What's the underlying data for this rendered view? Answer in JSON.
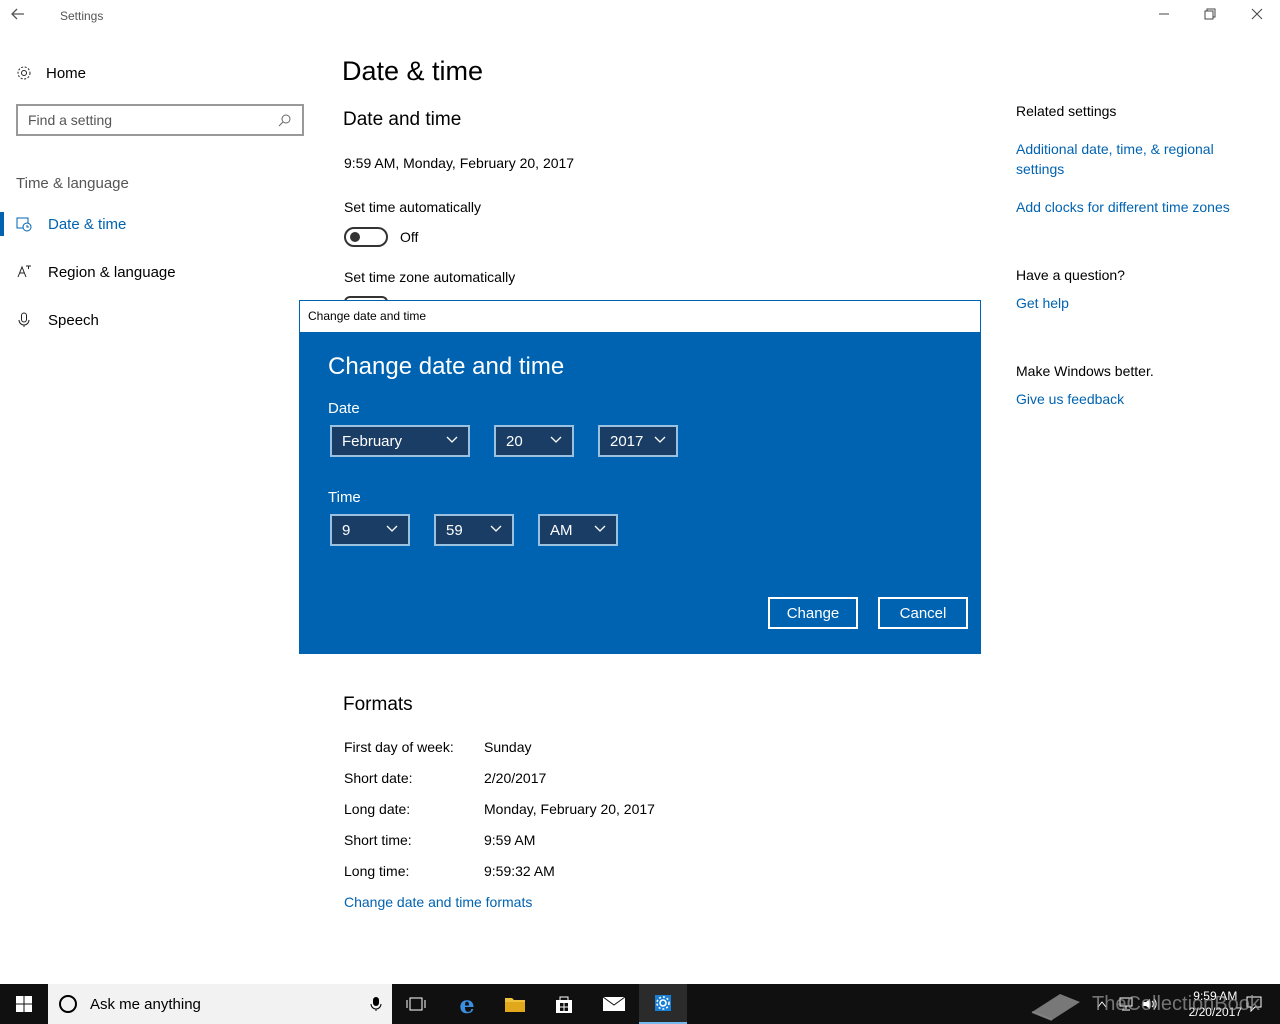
{
  "app": {
    "title": "Settings"
  },
  "sidebar": {
    "home": "Home",
    "search_placeholder": "Find a setting",
    "section": "Time & language",
    "items": [
      {
        "label": "Date & time",
        "icon": "calendar-clock-icon",
        "active": true
      },
      {
        "label": "Region & language",
        "icon": "language-icon",
        "active": false
      },
      {
        "label": "Speech",
        "icon": "microphone-icon",
        "active": false
      }
    ]
  },
  "main": {
    "page_title": "Date & time",
    "section_title": "Date and time",
    "current_datetime": "9:59 AM, Monday, February 20, 2017",
    "set_time_auto_label": "Set time automatically",
    "set_time_auto_state": "Off",
    "set_tz_auto_label": "Set time zone automatically",
    "formats": {
      "title": "Formats",
      "rows": [
        {
          "key": "First day of week:",
          "value": "Sunday"
        },
        {
          "key": "Short date:",
          "value": "2/20/2017"
        },
        {
          "key": "Long date:",
          "value": "Monday, February 20, 2017"
        },
        {
          "key": "Short time:",
          "value": "9:59 AM"
        },
        {
          "key": "Long time:",
          "value": "9:59:32 AM"
        }
      ],
      "change_link": "Change date and time formats"
    }
  },
  "related": {
    "title": "Related settings",
    "link1": "Additional date, time, & regional settings",
    "link2": "Add clocks for different time zones",
    "question_title": "Have a question?",
    "get_help": "Get help",
    "better_title": "Make Windows better.",
    "feedback": "Give us feedback"
  },
  "dialog": {
    "window_title": "Change date and time",
    "heading": "Change date and time",
    "date_label": "Date",
    "month": "February",
    "day": "20",
    "year": "2017",
    "time_label": "Time",
    "hour": "9",
    "minute": "59",
    "ampm": "AM",
    "change_btn": "Change",
    "cancel_btn": "Cancel"
  },
  "taskbar": {
    "cortana_text": "Ask me anything",
    "clock_time": "9:59 AM",
    "clock_date": "2/20/2017",
    "watermark": "TheCollectionBook"
  }
}
